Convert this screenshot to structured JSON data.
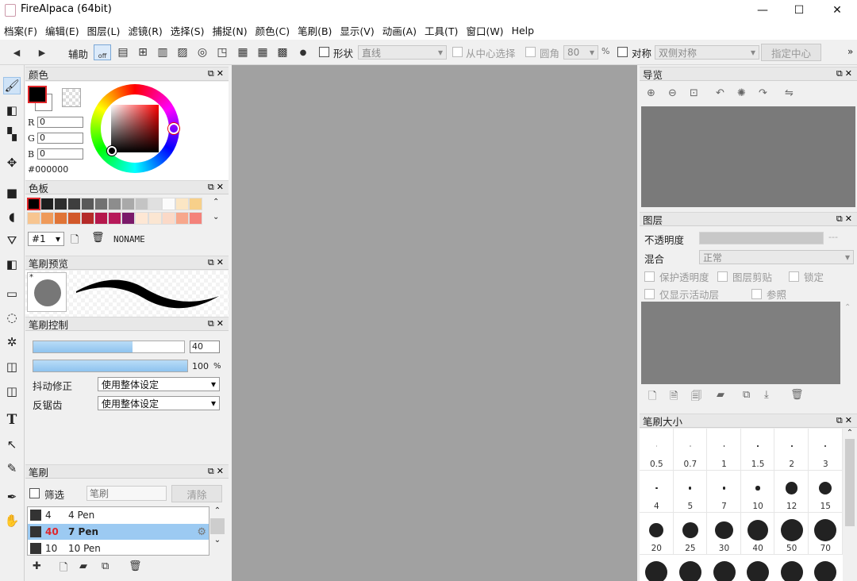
{
  "window": {
    "title": "FireAlpaca (64bit)",
    "minimize": "—",
    "maximize": "☐",
    "close": "✕"
  },
  "menu": [
    "档案(F)",
    "编辑(E)",
    "图层(L)",
    "滤镜(R)",
    "选择(S)",
    "捕捉(N)",
    "颜色(C)",
    "笔刷(B)",
    "显示(V)",
    "动画(A)",
    "工具(T)",
    "窗口(W)",
    "Help"
  ],
  "toolbar": {
    "assist_label": "辅助",
    "off_label": "off",
    "shape_label": "形状",
    "shape_value": "直线",
    "from_center_label": "从中心选择",
    "round_label": "圆角",
    "round_value": "80",
    "percent": "%",
    "symmetry_label": "对称",
    "symmetry_value": "双侧对称",
    "center_button": "指定中心",
    "more": "»"
  },
  "color_panel": {
    "title": "颜色",
    "r_label": "R",
    "r_value": "0",
    "g_label": "G",
    "g_value": "0",
    "b_label": "B",
    "b_value": "0",
    "hex": "#000000"
  },
  "palette_panel": {
    "title": "色板",
    "row1": [
      "#000000",
      "#1e1e1e",
      "#2e2e2e",
      "#3e3e3e",
      "#595959",
      "#727272",
      "#8d8d8d",
      "#a9a9a9",
      "#c4c4c4",
      "#e0e0e0",
      "#fbfbfb",
      "#fbe6c4",
      "#f7d08a"
    ],
    "row2": [
      "#f7c590",
      "#ef9a5a",
      "#e07436",
      "#d2582a",
      "#b52a28",
      "#b5174b",
      "#b71a5a",
      "#7b1a6a",
      "#fde7d4",
      "#fbe6d2",
      "#fbd9c7",
      "#f7a78c",
      "#f4827a"
    ],
    "set_value": "#1",
    "name": "NONAME"
  },
  "brush_preview": {
    "title": "笔刷预览",
    "star": "*"
  },
  "brush_control": {
    "title": "笔刷控制",
    "size_value": "40",
    "opacity_value": "100",
    "opacity_unit": "%",
    "stabilizer_label": "抖动修正",
    "stabilizer_value": "使用整体设定",
    "antialias_label": "反锯齿",
    "antialias_value": "使用整体设定"
  },
  "brush_panel": {
    "title": "笔刷",
    "filter_label": "筛选",
    "search_placeholder": "笔刷",
    "clear_button": "清除",
    "items": [
      {
        "size": "4",
        "name": "4 Pen"
      },
      {
        "size": "40",
        "name": "7 Pen"
      },
      {
        "size": "10",
        "name": "10 Pen"
      }
    ]
  },
  "navigator": {
    "title": "导览"
  },
  "layers": {
    "title": "图层",
    "opacity_label": "不透明度",
    "opacity_value": "---",
    "blend_label": "混合",
    "blend_value": "正常",
    "protect_alpha": "保护透明度",
    "clipping": "图层剪贴",
    "lock": "锁定",
    "show_active_only": "仅显示活动层",
    "reference": "参照"
  },
  "brush_size": {
    "title": "笔刷大小",
    "sizes": [
      "0.5",
      "0.7",
      "1",
      "1.5",
      "2",
      "3",
      "4",
      "5",
      "7",
      "10",
      "12",
      "15",
      "20",
      "25",
      "30",
      "40",
      "50",
      "70"
    ]
  },
  "colors": {
    "accent_blue": "#9ccaf2",
    "selection_red": "#e0262a",
    "canvas_gray": "#a1a1a1"
  }
}
